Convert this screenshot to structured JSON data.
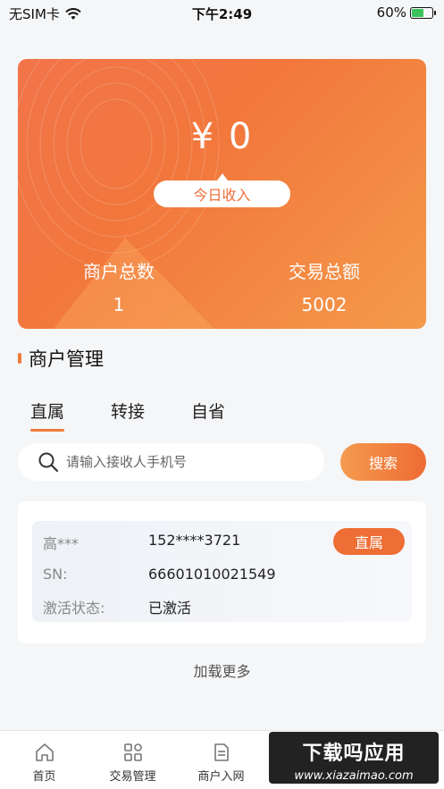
{
  "status_bar": {
    "carrier": "无SIM卡",
    "time": "下午2:49",
    "battery": "60%",
    "battery_level": 0.6
  },
  "hero": {
    "amount": "¥ 0",
    "today_income_label": "今日收入",
    "merchant_count_label": "商户总数",
    "merchant_count_value": "1",
    "trade_total_label": "交易总额",
    "trade_total_value": "5002"
  },
  "section": {
    "title": "商户管理"
  },
  "tabs": [
    {
      "label": "直属",
      "active": true
    },
    {
      "label": "转接",
      "active": false
    },
    {
      "label": "自省",
      "active": false
    }
  ],
  "search": {
    "placeholder": "请输入接收人手机号",
    "button_label": "搜索"
  },
  "merchant": {
    "name": "高***",
    "phone": "152****3721",
    "badge": "直属",
    "sn_label": "SN:",
    "sn_value": "66601010021549",
    "status_label": "激活状态:",
    "status_value": "已激活"
  },
  "load_more": "加载更多",
  "bottom_nav": [
    {
      "label": "首页",
      "icon": "home-icon"
    },
    {
      "label": "交易管理",
      "icon": "grid-icon"
    },
    {
      "label": "商户入网",
      "icon": "document-icon"
    }
  ],
  "watermark": {
    "title": "下载吗应用",
    "url": "www.xiazaimao.com"
  },
  "colors": {
    "accent": "#f07a3c",
    "hero_start": "#f2744a",
    "hero_end": "#f49a4a"
  }
}
